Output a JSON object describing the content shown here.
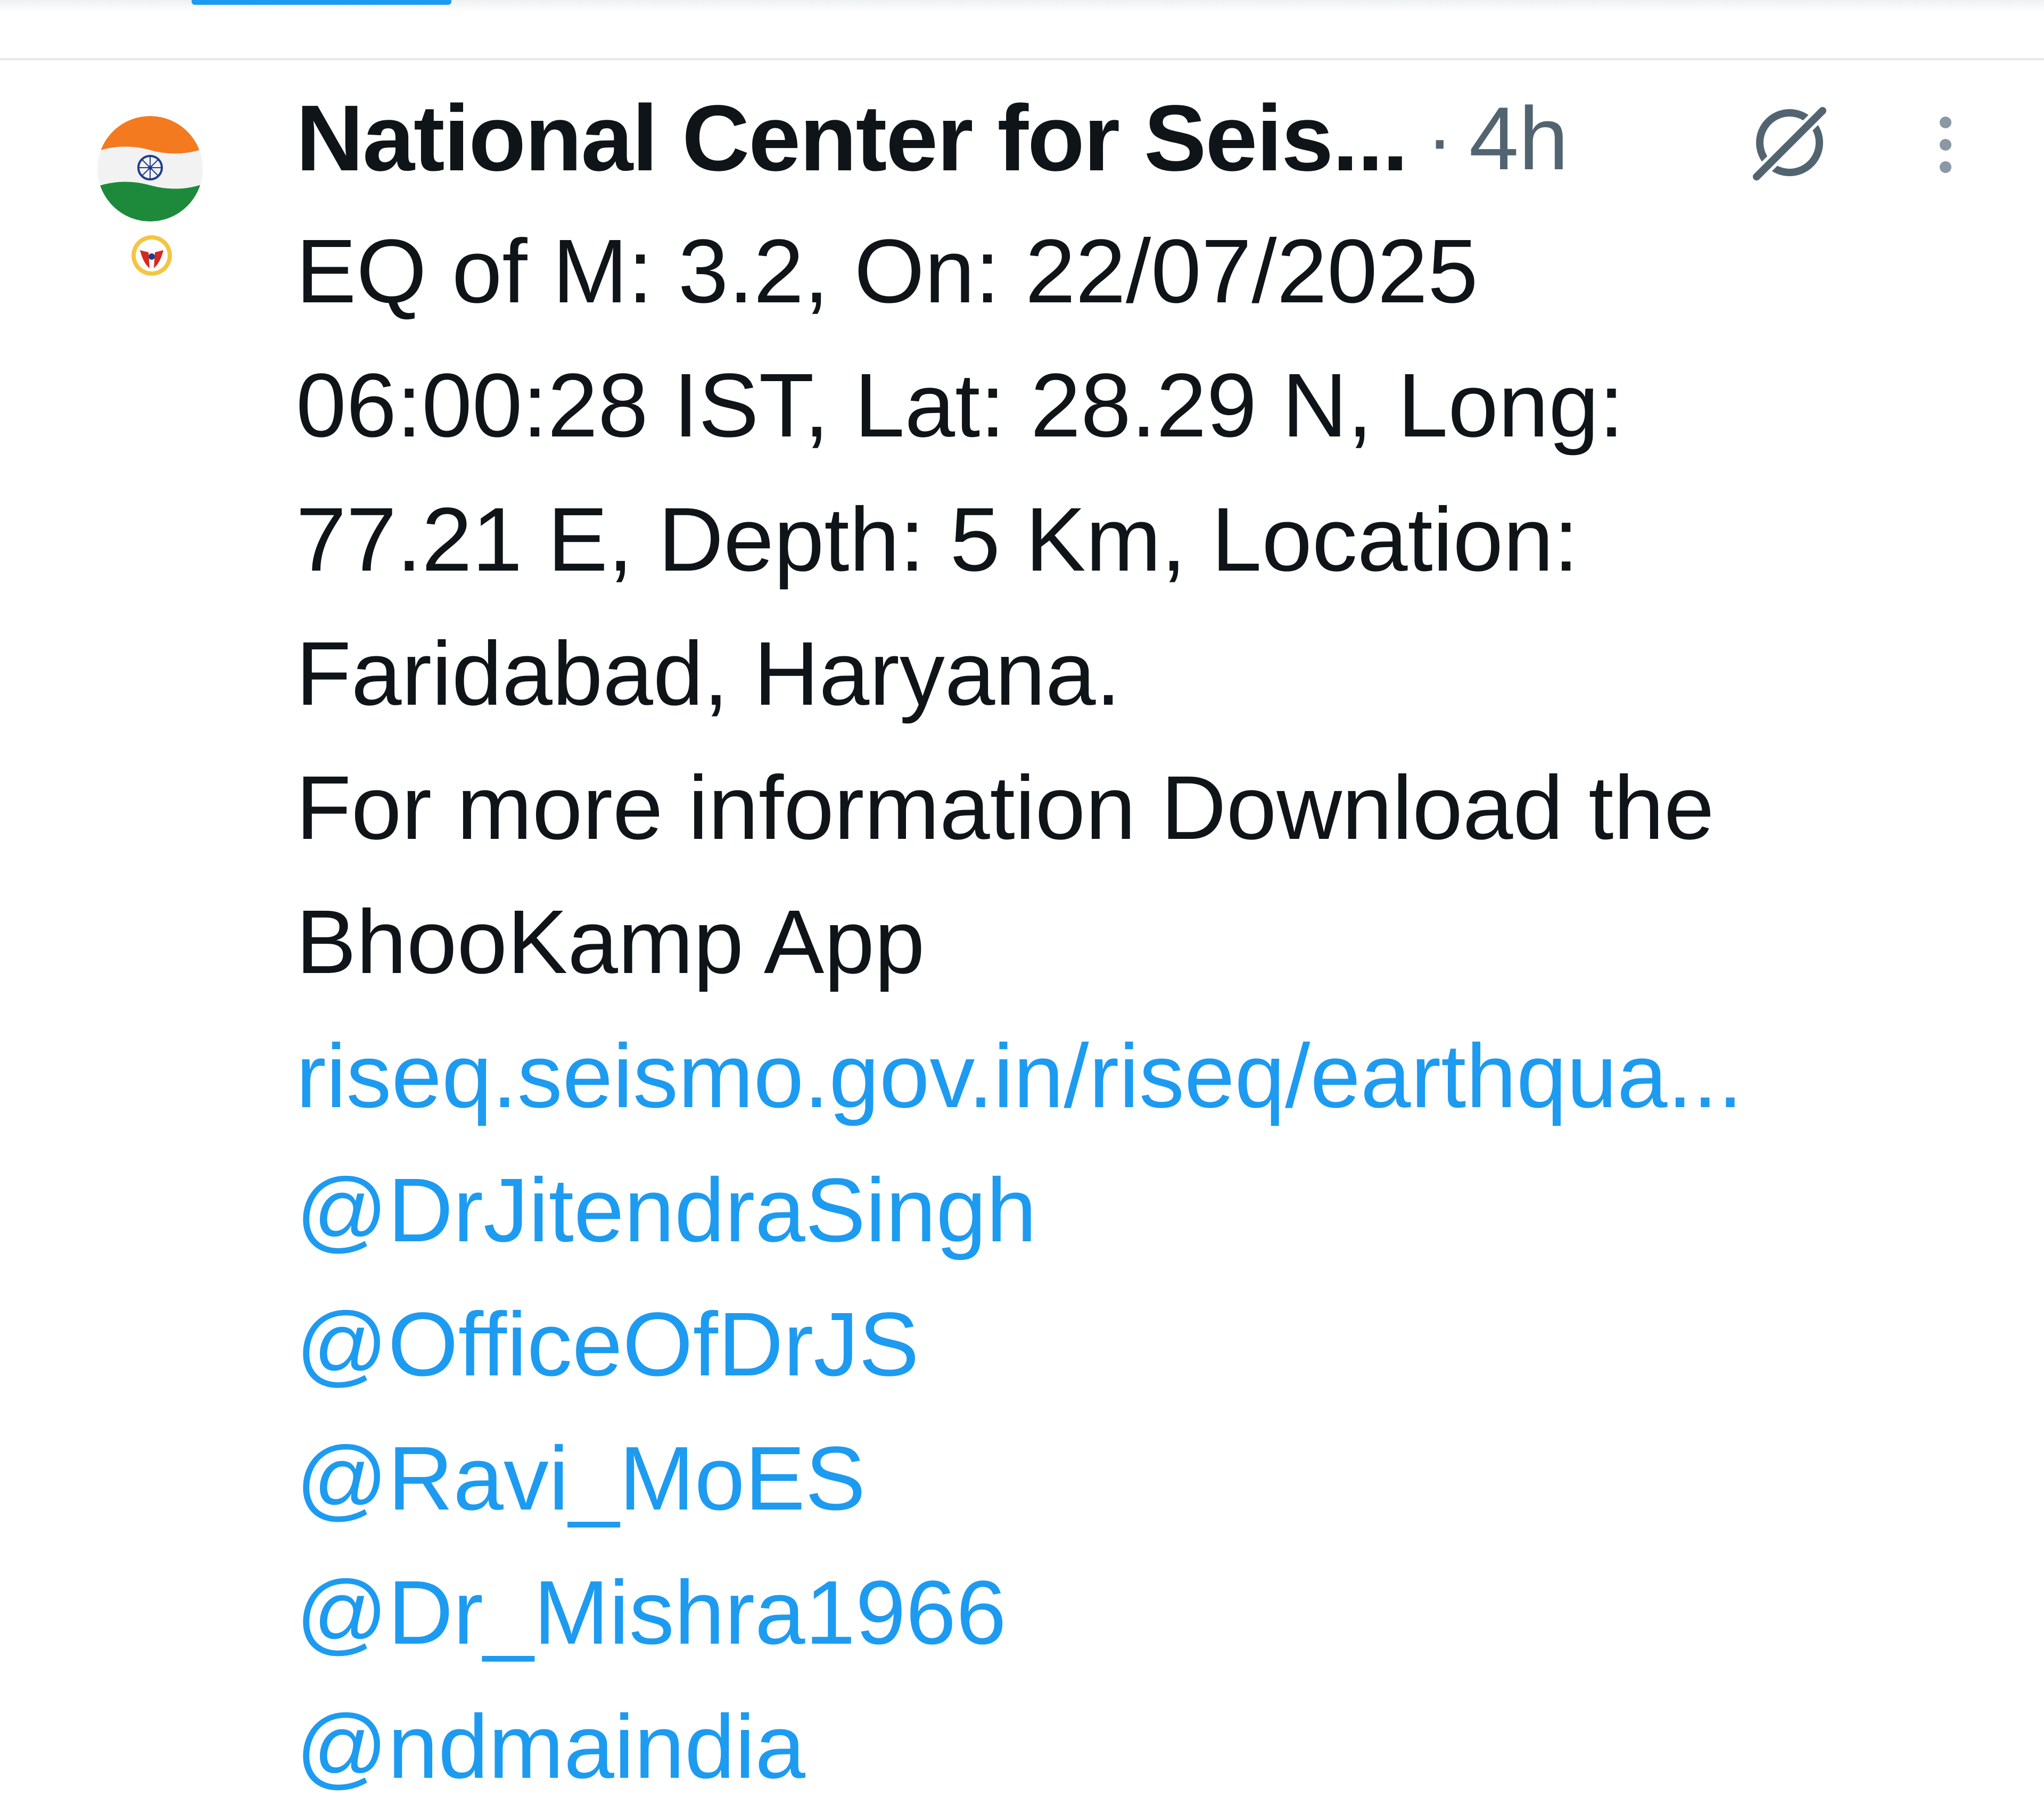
{
  "account": {
    "display_name": "National Center for Seis...",
    "separator": "·",
    "time_ago": "4h"
  },
  "icons": {
    "avatar": "india-flag-avatar",
    "affiliate_badge": "affiliation-badge-icon",
    "grok": "grok-icon",
    "more": "more-options-icon"
  },
  "colors": {
    "link": "#1d9bf0",
    "text": "#0f1419",
    "meta": "#536471"
  },
  "tweet": {
    "lines": [
      "EQ of M: 3.2, On: 22/07/2025",
      "06:00:28 IST, Lat: 28.29 N, Long:",
      "77.21 E, Depth: 5 Km, Location:",
      "Faridabad, Haryana.",
      "For more information Download the",
      "BhooKamp App"
    ],
    "link": "riseq.seismo.gov.in/riseq/earthqua...",
    "mentions": [
      "@DrJitendraSingh",
      "@OfficeOfDrJS",
      "@Ravi_MoES",
      "@Dr_Mishra1966",
      "@ndmaindia"
    ]
  }
}
